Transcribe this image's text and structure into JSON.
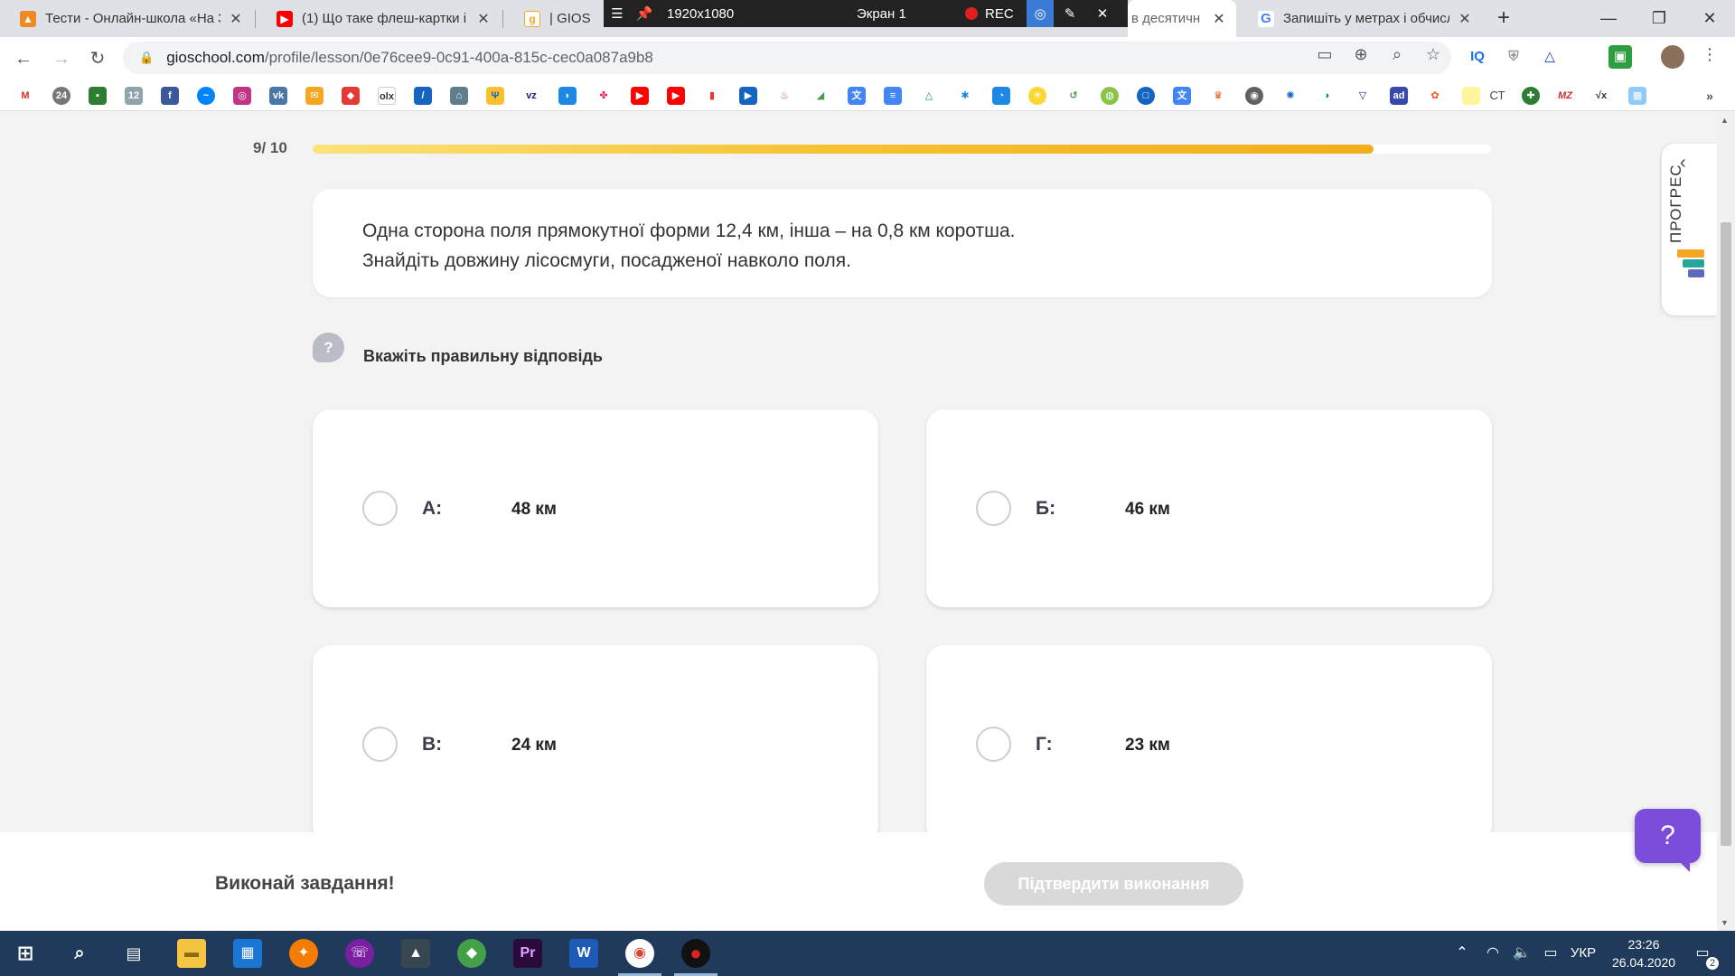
{
  "browser": {
    "tabs": [
      {
        "title": "Тести - Онлайн-школа «На З",
        "favicon": "vlc-cone-icon",
        "color": "#f08a24",
        "active": false
      },
      {
        "title": "(1) Що таке флеш-картки і я",
        "favicon": "youtube-icon",
        "color": "#ff0000",
        "active": false
      },
      {
        "title": "| GIOS",
        "favicon": "gios-icon",
        "color": "#f5a623",
        "active": false
      },
      {
        "title": "в десятичн",
        "favicon": "",
        "color": "#ffffff",
        "active": true
      },
      {
        "title": "Запишіть у метрах і обчисл",
        "favicon": "google-icon",
        "color": "#4285f4",
        "active": false
      }
    ],
    "new_tab_symbol": "+",
    "url_host": "gioschool.com",
    "url_path": "/profile/lesson/0e76cee9-0c91-400a-815c-cec0a087a9b8"
  },
  "recorder": {
    "resolution": "1920x1080",
    "screen": "Экран 1",
    "rec_label": "REC"
  },
  "lesson": {
    "progress_label": "9/ 10",
    "progress_fraction": 0.9,
    "question_line1": "Одна сторона поля прямокутної форми 12,4 км, інша – на 0,8 км коротша.",
    "question_line2": "Знайдіть довжину лісосмуги, посадженої навколо поля.",
    "hint_symbol": "?",
    "instruction": "Вкажіть правильну відповідь",
    "options": [
      {
        "letter": "А:",
        "value": "48 км"
      },
      {
        "letter": "Б:",
        "value": "46 км"
      },
      {
        "letter": "В:",
        "value": "24 км"
      },
      {
        "letter": "Г:",
        "value": "23 км"
      }
    ],
    "progress_panel_label": "ПРОГРЕС",
    "bottom_text": "Виконай завдання!",
    "confirm_label": "Підтвердити виконання",
    "help_symbol": "?"
  },
  "taskbar": {
    "language": "УКР",
    "time": "23:26",
    "date": "26.04.2020",
    "notification_count": "2"
  }
}
